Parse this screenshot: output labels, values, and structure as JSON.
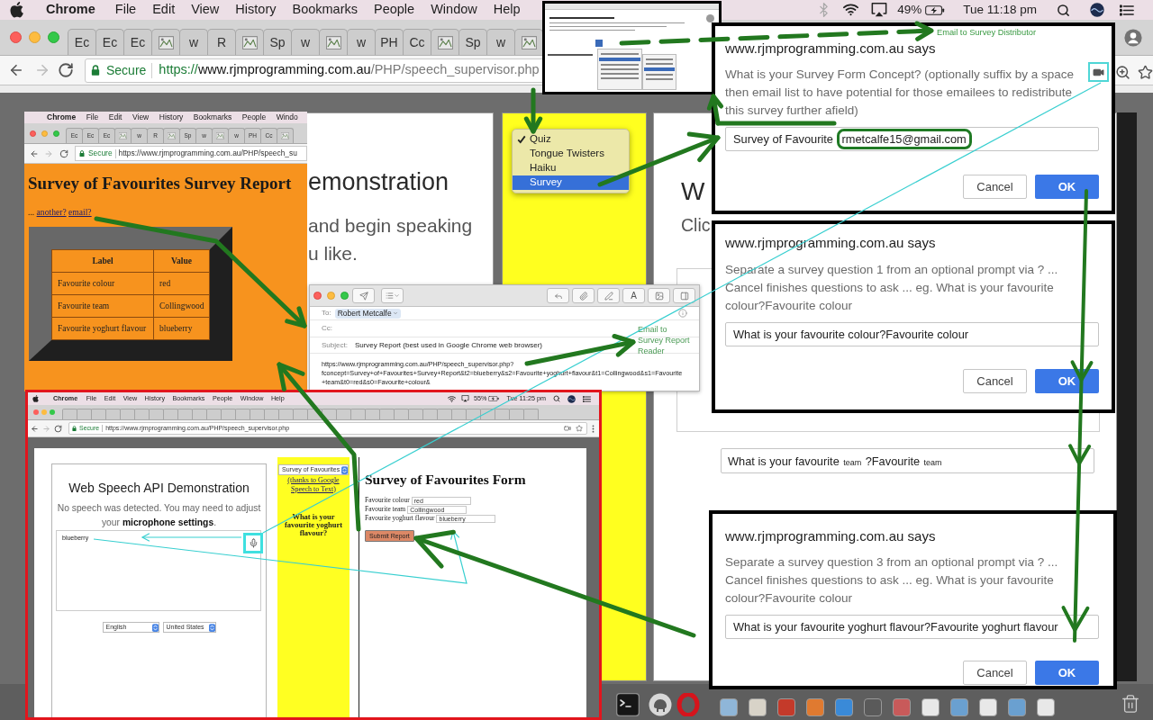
{
  "menubar": {
    "app": "Chrome",
    "menus": [
      "File",
      "Edit",
      "View",
      "History",
      "Bookmarks",
      "People",
      "Window",
      "Help"
    ],
    "battery": "49%",
    "clock": "Tue 11:18 pm"
  },
  "tabs": [
    {
      "kind": "text",
      "label": "Ec"
    },
    {
      "kind": "text",
      "label": "Ec"
    },
    {
      "kind": "text",
      "label": "Ec"
    },
    {
      "kind": "image"
    },
    {
      "kind": "text",
      "label": "w"
    },
    {
      "kind": "text",
      "label": "R"
    },
    {
      "kind": "image"
    },
    {
      "kind": "text",
      "label": "Sp"
    },
    {
      "kind": "text",
      "label": "w"
    },
    {
      "kind": "image"
    },
    {
      "kind": "text",
      "label": "w"
    },
    {
      "kind": "text",
      "label": "PH"
    },
    {
      "kind": "text",
      "label": "Cc"
    },
    {
      "kind": "image"
    },
    {
      "kind": "text",
      "label": "Sp"
    },
    {
      "kind": "text",
      "label": "w"
    },
    {
      "kind": "image"
    }
  ],
  "address_bar": {
    "security": "Secure",
    "scheme": "https://",
    "host": "www.rjmprogramming.com.au",
    "path": "/PHP/speech_supervisor.php"
  },
  "page": {
    "left_heading": "emonstration",
    "left_lines": [
      "and begin speaking",
      "u like."
    ],
    "mode_menu": [
      {
        "label": "Quiz",
        "checked": true,
        "selected": false
      },
      {
        "label": "Tongue Twisters",
        "checked": false,
        "selected": false
      },
      {
        "label": "Haiku",
        "checked": false,
        "selected": false
      },
      {
        "label": "Survey",
        "checked": false,
        "selected": true
      }
    ],
    "right_heading": "W",
    "right_text": "Clic",
    "team_field": {
      "segments": [
        {
          "kind": "normal",
          "text": "What is your favourite"
        },
        {
          "kind": "small",
          "text": "team"
        },
        {
          "kind": "normal",
          "text": "?Favourite"
        },
        {
          "kind": "small",
          "text": "team"
        }
      ]
    }
  },
  "dialogs": [
    {
      "title": "www.rjmprogramming.com.au says",
      "message": "What is your Survey Form Concept? (optionally suffix by a space then email list to have potential for those emailees to redistribute this survey further afield)",
      "value": "Survey of Favourite",
      "highlighted": "rmetcalfe15@gmail.com",
      "buttons": [
        {
          "kind": "secondary",
          "label": "Cancel"
        },
        {
          "kind": "primary",
          "label": "OK"
        }
      ]
    },
    {
      "title": "www.rjmprogramming.com.au says",
      "message": "Separate a survey question 1 from an optional prompt via ? ... Cancel finishes questions to ask ... eg. What is your favourite colour?Favourite colour",
      "value": "What is your favourite colour?Favourite colour",
      "buttons": [
        {
          "kind": "secondary",
          "label": "Cancel"
        },
        {
          "kind": "primary",
          "label": "OK"
        }
      ]
    },
    {
      "title": "www.rjmprogramming.com.au says",
      "message": "Separate a survey question 3 from an optional prompt via ? ... Cancel finishes questions to ask ... eg. What is your favourite colour?Favourite colour",
      "value": "What is your favourite yoghurt flavour?Favourite yoghurt flavour",
      "buttons": [
        {
          "kind": "secondary",
          "label": "Cancel"
        },
        {
          "kind": "primary",
          "label": "OK"
        }
      ]
    }
  ],
  "annotations": {
    "distributor_label": "Email to Survey Distributor",
    "reader_label": "Email to Survey Report Reader"
  },
  "report_window": {
    "menubar": {
      "app": "Chrome",
      "menus": [
        "File",
        "Edit",
        "View",
        "History",
        "Bookmarks",
        "People",
        "Windo"
      ]
    },
    "tabs": [
      {
        "kind": "text",
        "label": "Ec"
      },
      {
        "kind": "text",
        "label": "Ec"
      },
      {
        "kind": "text",
        "label": "Ec"
      },
      {
        "kind": "image"
      },
      {
        "kind": "text",
        "label": "w"
      },
      {
        "kind": "text",
        "label": "R"
      },
      {
        "kind": "image"
      },
      {
        "kind": "text",
        "label": "Sp"
      },
      {
        "kind": "text",
        "label": "w"
      },
      {
        "kind": "image"
      },
      {
        "kind": "text",
        "label": "w"
      },
      {
        "kind": "text",
        "label": "PH"
      },
      {
        "kind": "text",
        "label": "Cc"
      },
      {
        "kind": "image"
      }
    ],
    "security": "Secure",
    "url": "https://www.rjmprogramming.com.au/PHP/speech_su",
    "title": "Survey of Favourites Survey Report",
    "lead": "...",
    "links": [
      "another?",
      "email?"
    ],
    "table": {
      "columns": [
        "Label",
        "Value"
      ],
      "rows": [
        [
          "Favourite colour",
          "red"
        ],
        [
          "Favourite team",
          "Collingwood"
        ],
        [
          "Favourite yoghurt flavour",
          "blueberry"
        ]
      ]
    }
  },
  "email_window": {
    "to_label": "To:",
    "recipient": "Robert Metcalfe",
    "cc_label": "Cc:",
    "subject_label": "Subject:",
    "subject": "Survey Report (best used in Google Chrome web browser)",
    "body_lines": [
      "https://www.rjmprogramming.com.au/PHP/speech_supervisor.php?",
      "fconcept=Survey+of+Favourites+Survey+Report&t2=blueberry&s2=Favourite+yoghurt+flavour&t1=Collingwood&s1=Favourite",
      "+team&t0=red&s0=Favourite+colour&"
    ],
    "format_button": "A"
  },
  "form_window": {
    "menubar": {
      "app": "Chrome",
      "menus": [
        "File",
        "Edit",
        "View",
        "History",
        "Bookmarks",
        "People",
        "Window",
        "Help"
      ],
      "battery": "55%",
      "clock": "Tue 11:25 pm"
    },
    "security": "Secure",
    "url": "https://www.rjmprogramming.com.au/PHP/speech_supervisor.php",
    "speech_title": "Web Speech API Demonstration",
    "speech_status": "No speech was detected. You may need to adjust your **microphone settings**.",
    "transcript": "blueberry",
    "language": "English",
    "dialect": "United States",
    "survey_select": "Survey of Favourites",
    "credit_link": "(thanks to Google Speech to Text)",
    "question": "What is your favourite yoghurt flavour?",
    "form_title": "Survey of Favourites Form",
    "fields": [
      {
        "label": "Favourite colour",
        "value": "red"
      },
      {
        "label": "Favourite team",
        "value": "Collingwood"
      },
      {
        "label": "Favourite yoghurt flavour",
        "value": "blueberry"
      }
    ],
    "submit": "Submit Report"
  }
}
